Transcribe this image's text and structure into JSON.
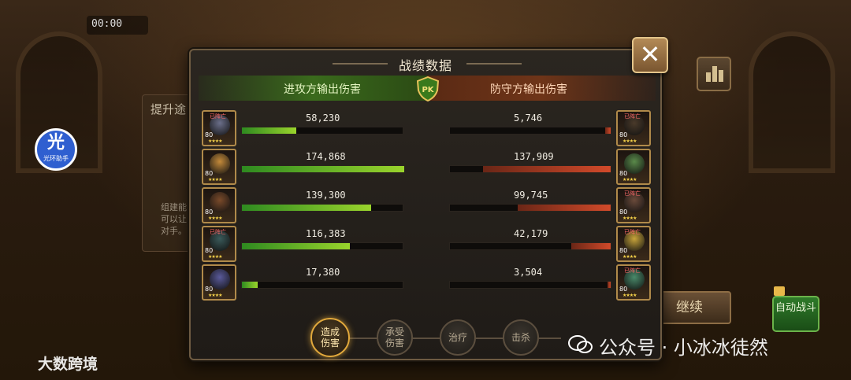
{
  "background": {
    "timer": "00:00",
    "panel_title": "提升途",
    "panel_sub": "组建能可以让对手。",
    "assist_badge": {
      "big": "光",
      "small": "光环助手"
    },
    "continue_label": "继续",
    "auto_battle_label": "自动战斗"
  },
  "watermarks": {
    "left": "大数跨境",
    "right": "公众号 · 小冰冰徒然"
  },
  "dialog": {
    "title": "战绩数据",
    "close_label": "✕",
    "attacker_header": "进攻方输出伤害",
    "defender_header": "防守方输出伤害",
    "pk_label": "PK",
    "max_damage": 174868,
    "attackers": [
      {
        "damage": "58,230",
        "value": 58230,
        "level": "80",
        "dead": true,
        "dead_label": "已阵亡",
        "stars": "★★★★",
        "color": "#6b6f8a"
      },
      {
        "damage": "174,868",
        "value": 174868,
        "level": "80",
        "dead": false,
        "stars": "★★★★",
        "color": "#c48a3a"
      },
      {
        "damage": "139,300",
        "value": 139300,
        "level": "80",
        "dead": false,
        "stars": "★★★★",
        "color": "#7a4a2a"
      },
      {
        "damage": "116,383",
        "value": 116383,
        "level": "80",
        "dead": true,
        "dead_label": "已阵亡",
        "stars": "★★★★",
        "color": "#3a5a5a"
      },
      {
        "damage": "17,380",
        "value": 17380,
        "level": "80",
        "dead": false,
        "stars": "★★★★",
        "color": "#5a5a9a"
      }
    ],
    "defenders": [
      {
        "damage": "5,746",
        "value": 5746,
        "level": "80",
        "dead": true,
        "dead_label": "已阵亡",
        "stars": "★★★★",
        "color": "#4a3a2a"
      },
      {
        "damage": "137,909",
        "value": 137909,
        "level": "80",
        "dead": false,
        "stars": "★★★★",
        "color": "#5a8a4a"
      },
      {
        "damage": "99,745",
        "value": 99745,
        "level": "80",
        "dead": true,
        "dead_label": "已阵亡",
        "stars": "★★★★",
        "color": "#6a4a3a"
      },
      {
        "damage": "42,179",
        "value": 42179,
        "level": "80",
        "dead": true,
        "dead_label": "已阵亡",
        "stars": "★★★★",
        "color": "#c8a43a"
      },
      {
        "damage": "3,504",
        "value": 3504,
        "level": "80",
        "dead": true,
        "dead_label": "已阵亡",
        "stars": "★★★★",
        "color": "#4a8a6a"
      }
    ],
    "tabs": [
      {
        "label": "造成伤害",
        "active": true
      },
      {
        "label": "承受伤害",
        "active": false
      },
      {
        "label": "治疗",
        "active": false
      },
      {
        "label": "击杀",
        "active": false
      }
    ]
  },
  "colors": {
    "attacker_bar": "#7cc42a",
    "defender_bar": "#c8442a",
    "active_tab": "#e2a93c"
  }
}
